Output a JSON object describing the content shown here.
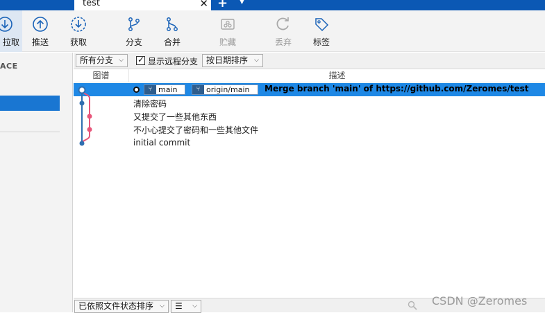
{
  "window": {
    "tab_title": "test",
    "tab_close": "✕",
    "new_tab": "+",
    "tab_menu": "▼"
  },
  "toolbar": {
    "pull": "拉取",
    "push": "推送",
    "fetch": "获取",
    "branch": "分支",
    "merge": "合并",
    "stash": "贮藏",
    "discard": "丢弃",
    "tag": "标签"
  },
  "sidebar": {
    "workspace_label": "ACE"
  },
  "filters": {
    "branch_filter": "所有分支",
    "show_remote_label": "显示远程分支",
    "show_remote_checked": true,
    "sort_order": "按日期排序"
  },
  "columns": {
    "graph": "图谱",
    "description": "描述"
  },
  "commits": [
    {
      "message": "Merge branch 'main' of https://github.com/Zeromes/test",
      "refs": [
        "main",
        "origin/main"
      ],
      "selected": true
    },
    {
      "message": "清除密码",
      "refs": [],
      "selected": false
    },
    {
      "message": "又提交了一些其他东西",
      "refs": [],
      "selected": false
    },
    {
      "message": "不小心提交了密码和一些其他文件",
      "refs": [],
      "selected": false
    },
    {
      "message": "initial commit",
      "refs": [],
      "selected": false
    }
  ],
  "bottom": {
    "file_sort": "已依照文件状态排序",
    "view_mode": "☰"
  },
  "watermark": "CSDN @Zeromes",
  "colors": {
    "accent": "#1e88e5",
    "title_bar": "#0b58b4",
    "graph_main": "#2f6fb0",
    "graph_branch": "#e8557a"
  }
}
